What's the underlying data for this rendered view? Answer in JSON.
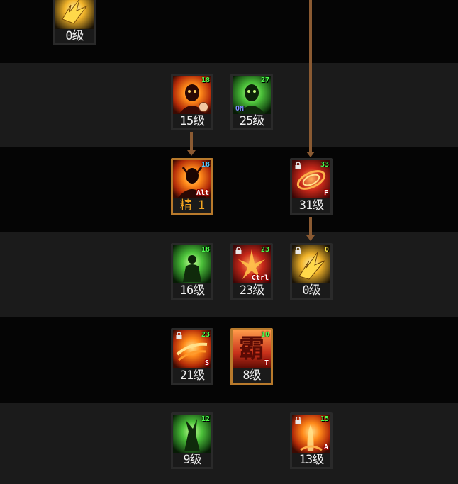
{
  "skills": [
    {
      "id": "s0",
      "level_text": "0级",
      "lv_badge": "",
      "lock": false,
      "key": "",
      "theme": "yellow"
    },
    {
      "id": "s1",
      "level_text": "15级",
      "lv_badge": "18",
      "lock": false,
      "key": "",
      "theme": "fire",
      "badge_color": "green",
      "clock": true
    },
    {
      "id": "s2",
      "level_text": "25级",
      "lv_badge": "27",
      "lock": false,
      "key": "",
      "on_text": "ON",
      "theme": "green",
      "badge_color": "green"
    },
    {
      "id": "s3",
      "level_text": "精 1",
      "lv_badge": "18",
      "lock": false,
      "key": "Alt",
      "theme": "fire",
      "badge_color": "blue"
    },
    {
      "id": "s4",
      "level_text": "31级",
      "lv_badge": "33",
      "lock": true,
      "key": "F",
      "theme": "red",
      "badge_color": "green"
    },
    {
      "id": "s5",
      "level_text": "16级",
      "lv_badge": "18",
      "lock": false,
      "key": "",
      "theme": "green",
      "badge_color": "green"
    },
    {
      "id": "s6",
      "level_text": "23级",
      "lv_badge": "23",
      "lock": true,
      "key": "Ctrl",
      "theme": "red",
      "badge_color": "green"
    },
    {
      "id": "s7",
      "level_text": "0级",
      "lv_badge": "0",
      "lock": true,
      "key": "",
      "theme": "yellow",
      "badge_color": "yellow"
    },
    {
      "id": "s8",
      "level_text": "21级",
      "lv_badge": "23",
      "lock": true,
      "key": "S",
      "theme": "fire",
      "badge_color": "green"
    },
    {
      "id": "s9",
      "level_text": "8级",
      "lv_badge": "10",
      "lock": false,
      "key": "T",
      "glyph": "霸",
      "theme": "glyph",
      "badge_color": "green"
    },
    {
      "id": "s10",
      "level_text": "9级",
      "lv_badge": "12",
      "lock": false,
      "key": "",
      "theme": "green",
      "badge_color": "green"
    },
    {
      "id": "s11",
      "level_text": "13级",
      "lv_badge": "15",
      "lock": true,
      "key": "A",
      "theme": "fire",
      "badge_color": "green"
    }
  ],
  "colors": {
    "connector": "#8a5a32",
    "band_dark": "#050505",
    "band_light": "#1b1b1b",
    "selected_border": "#b87a2c"
  }
}
